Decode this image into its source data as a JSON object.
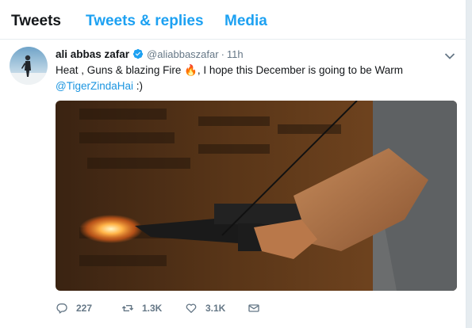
{
  "tabs": [
    {
      "label": "Tweets",
      "active": true
    },
    {
      "label": "Tweets & replies",
      "active": false
    },
    {
      "label": "Media",
      "active": false
    }
  ],
  "tweet": {
    "author_name": "ali abbas zafar",
    "handle": "@aliabbaszafar",
    "separator": "·",
    "time": "11h",
    "text_line1": "Heat , Guns & blazing Fire",
    "emoji": "🔥",
    "text_line1_rest": ", I hope this December is going to be Warm",
    "mention": "@TigerZindaHai",
    "text_end": " :)",
    "media_icon": "photo",
    "verified_icon": "verified-badge-icon"
  },
  "actions": {
    "replies": "227",
    "retweets": "1.3K",
    "likes": "3.1K"
  },
  "colors": {
    "accent": "#1da1f2",
    "link": "#1b95e0",
    "muted": "#657786",
    "text": "#14171a"
  }
}
